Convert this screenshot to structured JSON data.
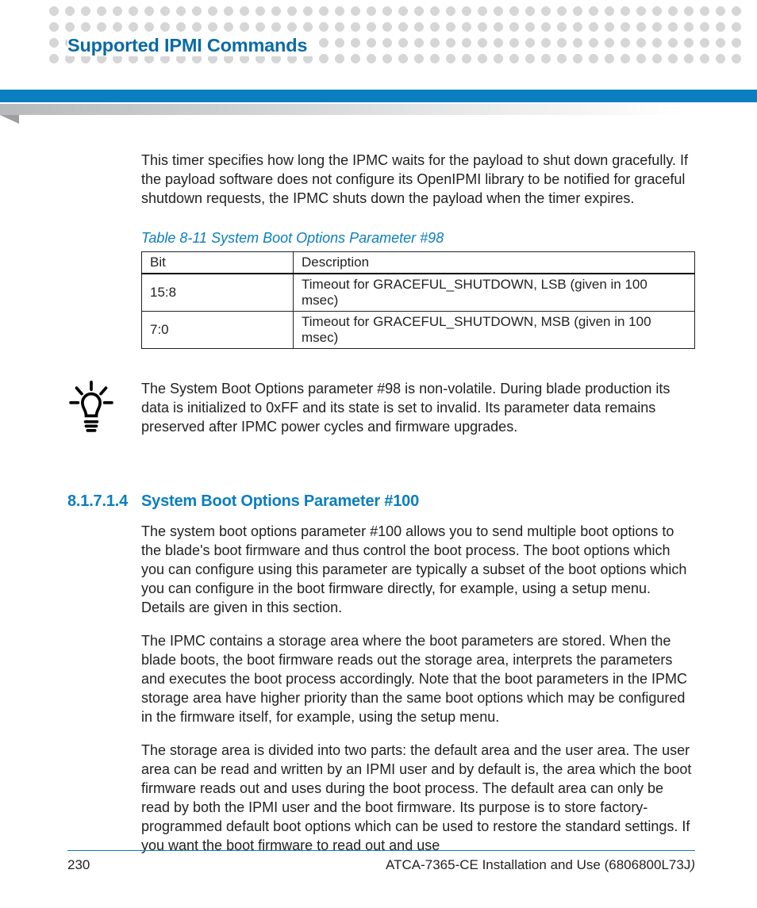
{
  "header": {
    "running_title": "Supported IPMI Commands"
  },
  "body": {
    "para1": "This timer specifies how long the IPMC waits for the payload to shut down gracefully. If the payload software does not configure its OpenIPMI library to be notified for graceful shutdown requests, the IPMC shuts down the payload when the timer expires.",
    "table_caption": "Table 8-11 System Boot Options Parameter #98",
    "table": {
      "headers": {
        "c0": "Bit",
        "c1": "Description"
      },
      "rows": [
        {
          "c0": "15:8",
          "c1": "Timeout for GRACEFUL_SHUTDOWN, LSB (given in 100 msec)"
        },
        {
          "c0": "7:0",
          "c1": "Timeout for GRACEFUL_SHUTDOWN, MSB (given in 100 msec)"
        }
      ]
    },
    "note": "The System Boot Options parameter #98 is non-volatile. During blade production its data is initialized to 0xFF and its state is set to invalid. Its parameter data remains preserved after IPMC power cycles and firmware upgrades.",
    "section": {
      "num": "8.1.7.1.4",
      "title": "System Boot Options Parameter #100",
      "p1": "The system boot options parameter #100 allows you to send multiple boot options to the blade's boot firmware and thus control the boot process. The boot options which you can configure using this parameter are typically a subset of the boot options which you can configure in the boot firmware directly, for example, using a setup menu. Details are given in this section.",
      "p2": "The IPMC contains a storage area where the boot parameters are stored. When the blade boots, the boot firmware reads out the storage area, interprets the parameters and executes the boot process accordingly. Note that the boot parameters in the IPMC storage area have higher priority than the same boot options which may be configured in the firmware itself, for example, using the setup menu.",
      "p3": "The storage area is divided into two parts: the default area and the user area. The user area can be read and written by an IPMI user and by default is, the area which the boot firmware reads out and uses during the boot process. The default area can only be read by both the IPMI user and the boot firmware. Its purpose is to store factory-programmed default boot options which can be used to restore the standard settings. If you want the boot firmware to read out and use"
    }
  },
  "footer": {
    "page_number": "230",
    "doc_title": "ATCA-7365-CE Installation and Use (6806800L73J",
    "doc_tail": ")"
  }
}
